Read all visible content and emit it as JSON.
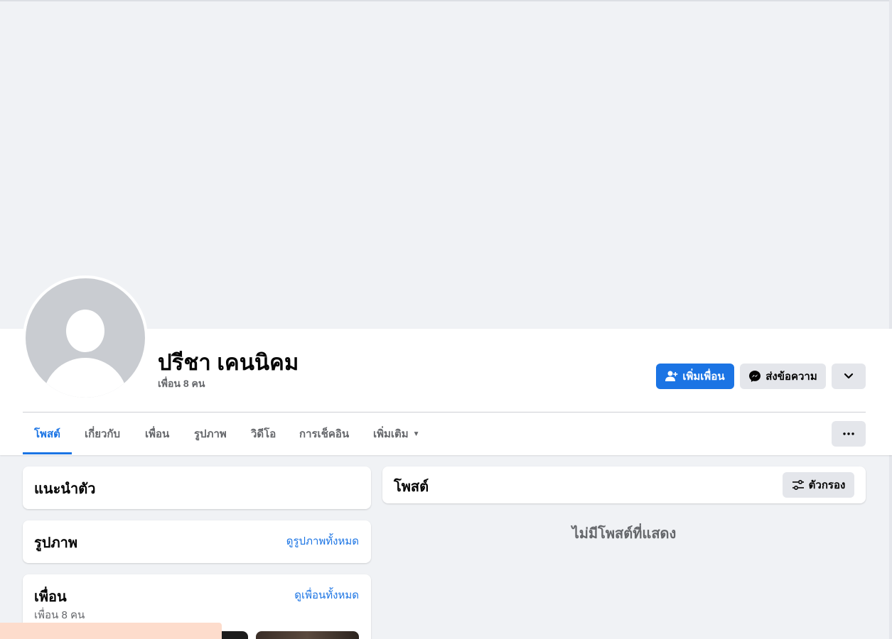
{
  "profile": {
    "name": "ปรีชา เคนนิคม",
    "friend_count": "เพื่อน 8 คน"
  },
  "actions": {
    "add_friend": "เพิ่มเพื่อน",
    "message": "ส่งข้อความ"
  },
  "tabs": [
    {
      "label": "โพสต์",
      "active": true
    },
    {
      "label": "เกี่ยวกับ"
    },
    {
      "label": "เพื่อน"
    },
    {
      "label": "รูปภาพ"
    },
    {
      "label": "วิดีโอ"
    },
    {
      "label": "การเช็คอิน"
    },
    {
      "label": "เพิ่มเติม"
    }
  ],
  "intro": {
    "title": "แนะนำตัว"
  },
  "photos": {
    "title": "รูปภาพ",
    "see_all": "ดูรูปภาพทั้งหมด"
  },
  "friends": {
    "title": "เพื่อน",
    "see_all": "ดูเพื่อนทั้งหมด",
    "count": "เพื่อน 8 คน"
  },
  "posts": {
    "title": "โพสต์",
    "filter": "ตัวกรอง",
    "empty": "ไม่มีโพสต์ที่แสดง"
  },
  "colors": {
    "accent": "#1b74e4",
    "background": "#f0f2f5",
    "secondary_button": "#e4e6eb"
  }
}
